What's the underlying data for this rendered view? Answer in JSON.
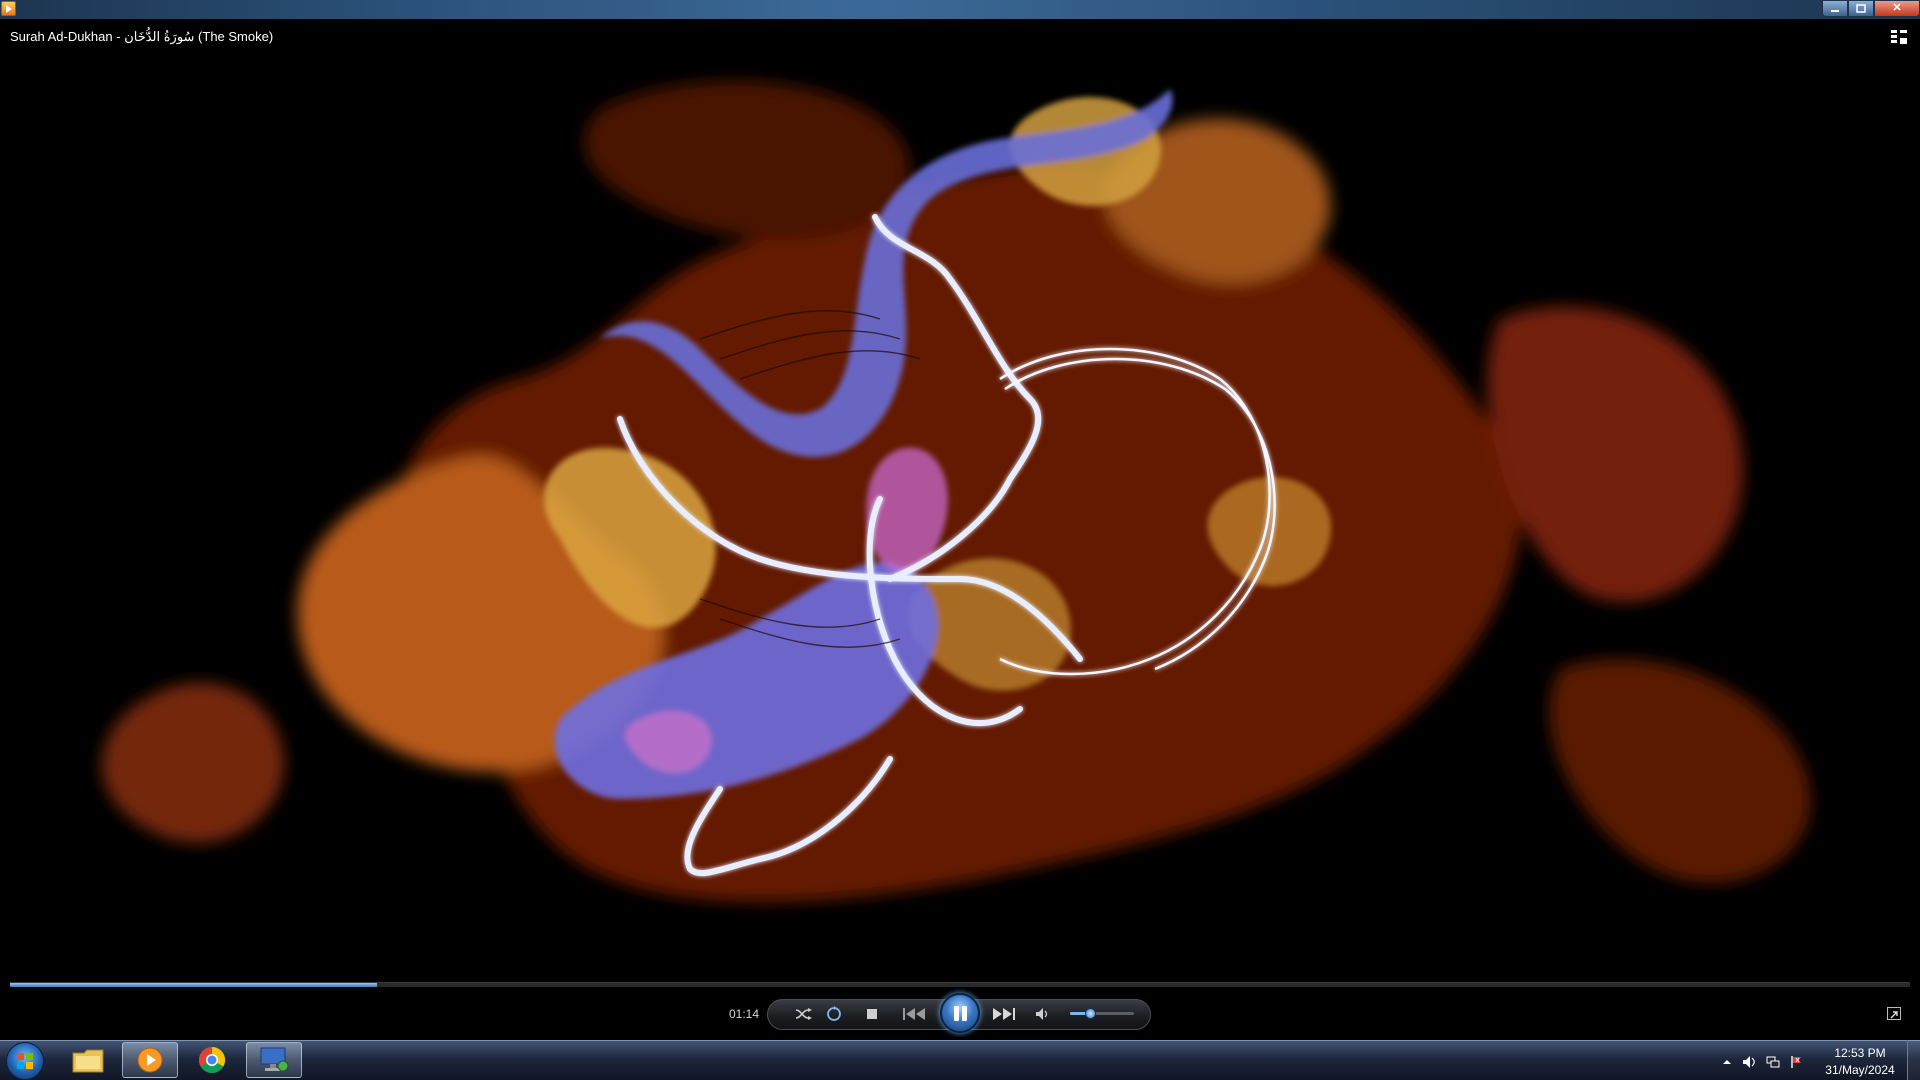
{
  "window": {
    "title": "Surah Ad-Dukhan - سُورَةُ الدُّخَان (The Smoke)",
    "minimize_icon": "minimize-icon",
    "maximize_icon": "maximize-icon",
    "close_label": "✕"
  },
  "player": {
    "elapsed": "01:14",
    "seek_progress_fraction": 0.193,
    "volume_fraction": 0.32,
    "state": "playing",
    "controls": [
      "shuffle-icon",
      "repeat-icon",
      "stop-icon",
      "previous-icon",
      "pause-icon",
      "next-icon",
      "mute-icon"
    ],
    "accent": "#3f78b8"
  },
  "taskbar": {
    "pinned": [
      "windows-explorer-icon",
      "media-player-icon",
      "chrome-icon",
      "remote-desktop-icon"
    ],
    "clock_time": "12:53 PM",
    "clock_date": "31/May/2024"
  }
}
